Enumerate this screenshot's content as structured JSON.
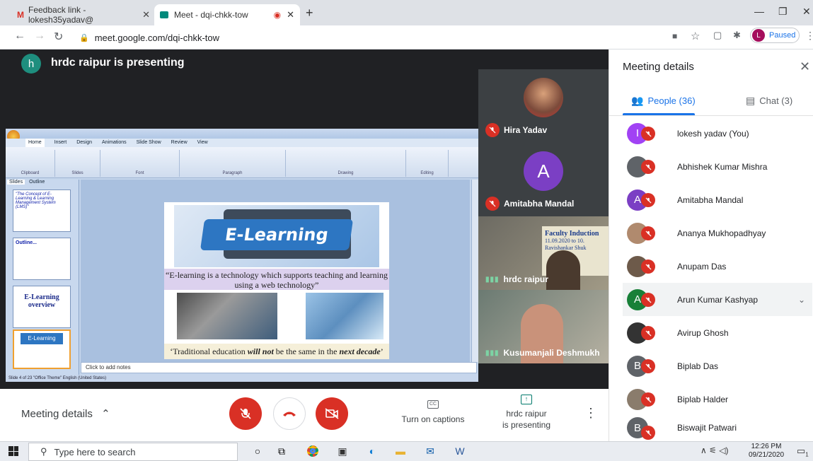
{
  "browser": {
    "tabs": [
      {
        "icon": "gmail-icon",
        "label": "Feedback link - lokesh35yadav@"
      },
      {
        "icon": "meet-icon",
        "label": "Meet - dqi-chkk-tow"
      }
    ],
    "url": "meet.google.com/dqi-chkk-tow",
    "profile_initial": "L",
    "profile_status": "Paused"
  },
  "meeting": {
    "presenter_initial": "h",
    "presenter_banner": "hrdc raipur is presenting",
    "participant_tiles": [
      {
        "name": "Hira Yadav",
        "muted": true
      },
      {
        "name": "Amitabha Mandal",
        "initial": "A",
        "muted": true
      },
      {
        "name": "hrdc raipur",
        "muted": false
      },
      {
        "name": "Kusumanjali Deshmukh",
        "muted": false
      }
    ],
    "tile_banner_lines": [
      "Faculty Induction",
      "11.09.2020 to 10.",
      "Ravishankar Shuk"
    ],
    "controls": {
      "meeting_details": "Meeting details",
      "captions": "Turn on captions",
      "presenting_line1": "hrdc raipur",
      "presenting_line2": "is presenting"
    }
  },
  "ppt": {
    "tabs": [
      "Home",
      "Insert",
      "Design",
      "Animations",
      "Slide Show",
      "Review",
      "View"
    ],
    "ribbon_groups": [
      "Clipboard",
      "Slides",
      "Font",
      "Paragraph",
      "Drawing",
      "Editing"
    ],
    "left_tabs": [
      "Slides",
      "Outline"
    ],
    "thumbs": [
      "\"The Concept of E-Learning & Learning Management System (LMS)\"",
      "Outline...",
      "E-Learning overview",
      "E-Learning"
    ],
    "slide_logo": "E-Learning",
    "slide_quote": "“E-learning is a technology which supports teaching and learning using a web technology”",
    "slide_quote2_a": "‘Traditional education ",
    "slide_quote2_b": "will not",
    "slide_quote2_c": " be the same in the ",
    "slide_quote2_d": "next decade",
    "slide_quote2_e": "’",
    "notes_placeholder": "Click to add notes",
    "status": "Slide 4 of 23   \"Office Theme\"   English (United States)"
  },
  "panel": {
    "title": "Meeting details",
    "people_tab": "People (36)",
    "chat_tab": "Chat (3)",
    "people": [
      {
        "name": "lokesh yadav (You)",
        "initial": "I",
        "color": "#a142f4"
      },
      {
        "name": "Abhishek Kumar Mishra",
        "initial": "",
        "color": "#5f6368"
      },
      {
        "name": "Amitabha Mandal",
        "initial": "A",
        "color": "#7b3fc4"
      },
      {
        "name": "Ananya Mukhopadhyay",
        "initial": "",
        "color": "#b08a6e"
      },
      {
        "name": "Anupam Das",
        "initial": "",
        "color": "#6d5a4a"
      },
      {
        "name": "Arun Kumar Kashyap",
        "initial": "A",
        "color": "#188038"
      },
      {
        "name": "Avirup Ghosh",
        "initial": "",
        "color": "#333333"
      },
      {
        "name": "Biplab Das",
        "initial": "B",
        "color": "#5f6368"
      },
      {
        "name": "Biplab Halder",
        "initial": "",
        "color": "#8a7c6c"
      },
      {
        "name": "Biswajit Patwari",
        "initial": "B",
        "color": "#5f6368"
      }
    ]
  },
  "taskbar": {
    "search_placeholder": "Type here to search",
    "time": "12:26 PM",
    "date": "09/21/2020",
    "notifications": "1"
  }
}
